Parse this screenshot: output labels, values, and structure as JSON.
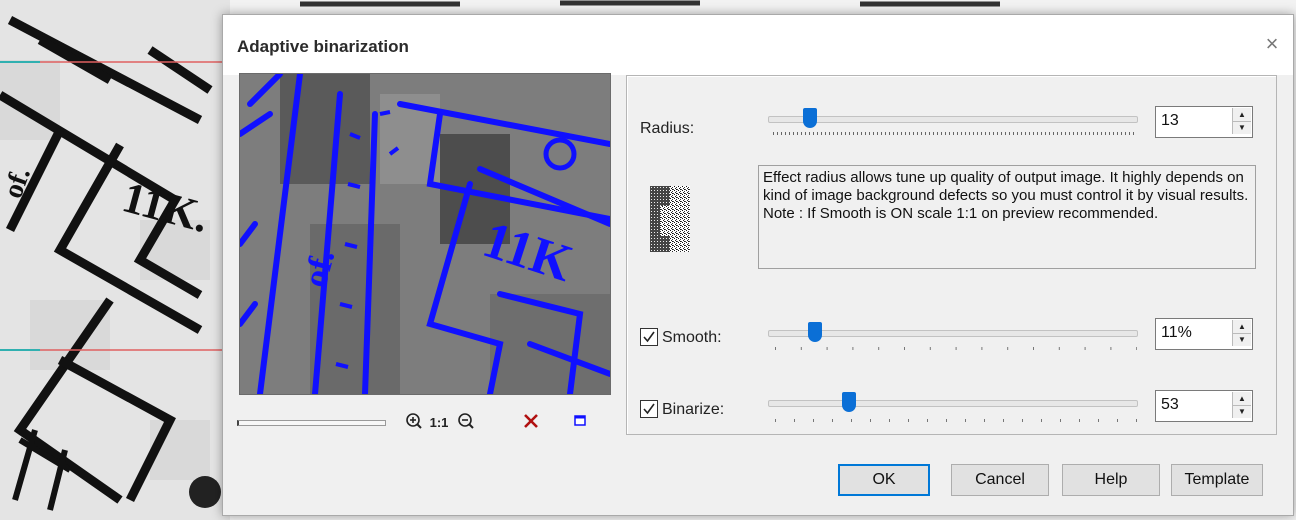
{
  "dialog": {
    "title": "Adaptive binarization",
    "close_glyph": "×"
  },
  "preview_tools": {
    "zoom_in_icon": "zoom-in-icon",
    "actual_size_label": "1:1",
    "zoom_out_icon": "zoom-out-icon",
    "cancel_icon": "red-x-icon",
    "frame_icon": "blue-square-icon"
  },
  "settings": {
    "radius": {
      "label": "Radius:",
      "value": "13"
    },
    "description": {
      "text": "Effect radius allows tune up quality of output image. It highly depends on kind of image background defects so you must control it by visual results.\nNote : If Smooth is ON scale 1:1 on preview recommended."
    },
    "smooth": {
      "label": "Smooth:",
      "checked": true,
      "value": "11%"
    },
    "binarize": {
      "label": "Binarize:",
      "checked": true,
      "value": "53"
    }
  },
  "buttons": {
    "ok": "OK",
    "cancel": "Cancel",
    "help": "Help",
    "template": "Template"
  },
  "colors": {
    "accent": "#0078d7",
    "slider_thumb": "#0b6fd6",
    "preview_lines": "#1010ff",
    "cancel_icon": "#b01010"
  }
}
